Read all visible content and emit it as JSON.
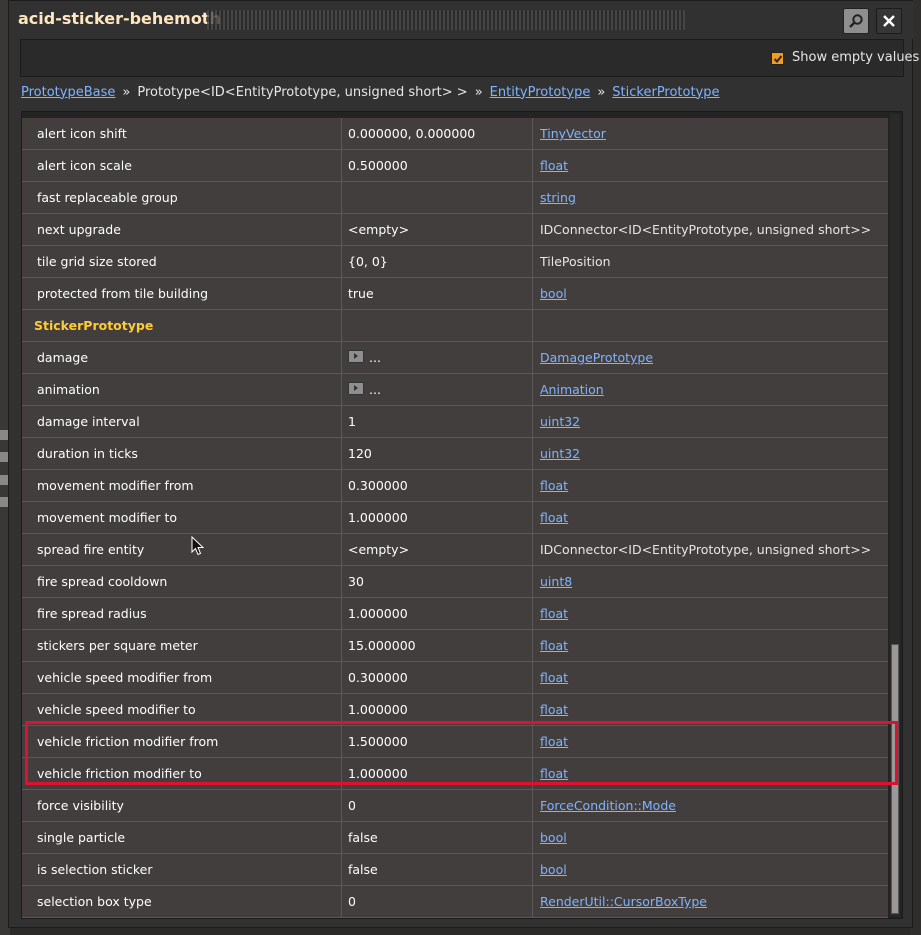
{
  "window": {
    "title": "acid-sticker-behemoth",
    "icons": {
      "search": "magnifier-icon",
      "close": "close-icon"
    }
  },
  "header": {
    "show_empty_values": {
      "label": "Show empty values",
      "checked": true
    }
  },
  "breadcrumb": {
    "items": [
      {
        "label": "PrototypeBase",
        "link": true
      },
      {
        "label": "Prototype<ID<EntityPrototype, unsigned short> >",
        "link": false
      },
      {
        "label": "EntityPrototype",
        "link": true
      },
      {
        "label": "StickerPrototype",
        "link": true
      }
    ],
    "separator": "»"
  },
  "rows": [
    {
      "name": "alert icon shift",
      "value": "0.000000, 0.000000",
      "type": "TinyVector",
      "type_link": true
    },
    {
      "name": "alert icon scale",
      "value": "0.500000",
      "type": "float",
      "type_link": true
    },
    {
      "name": "fast replaceable group",
      "value": "",
      "type": "string",
      "type_link": true
    },
    {
      "name": "next upgrade",
      "value": "<empty>",
      "type": "IDConnector<ID<EntityPrototype, unsigned short>>",
      "type_link": false
    },
    {
      "name": "tile grid size stored",
      "value": "{0, 0}",
      "type": "TilePosition",
      "type_link": false
    },
    {
      "name": "protected from tile building",
      "value": "true",
      "type": "bool",
      "type_link": true
    },
    {
      "name": "StickerPrototype",
      "value": "",
      "type": "",
      "section": true
    },
    {
      "name": "damage",
      "value": "...",
      "type": "DamagePrototype",
      "type_link": true,
      "expandable": true
    },
    {
      "name": "animation",
      "value": "...",
      "type": "Animation",
      "type_link": true,
      "expandable": true
    },
    {
      "name": "damage interval",
      "value": "1",
      "type": "uint32",
      "type_link": true
    },
    {
      "name": "duration in ticks",
      "value": "120",
      "type": "uint32",
      "type_link": true
    },
    {
      "name": "movement modifier from",
      "value": "0.300000",
      "type": "float",
      "type_link": true
    },
    {
      "name": "movement modifier to",
      "value": "1.000000",
      "type": "float",
      "type_link": true
    },
    {
      "name": "spread fire entity",
      "value": "<empty>",
      "type": "IDConnector<ID<EntityPrototype, unsigned short>>",
      "type_link": false
    },
    {
      "name": "fire spread cooldown",
      "value": "30",
      "type": "uint8",
      "type_link": true
    },
    {
      "name": "fire spread radius",
      "value": "1.000000",
      "type": "float",
      "type_link": true
    },
    {
      "name": "stickers per square meter",
      "value": "15.000000",
      "type": "float",
      "type_link": true
    },
    {
      "name": "vehicle speed modifier from",
      "value": "0.300000",
      "type": "float",
      "type_link": true
    },
    {
      "name": "vehicle speed modifier to",
      "value": "1.000000",
      "type": "float",
      "type_link": true
    },
    {
      "name": "vehicle friction modifier from",
      "value": "1.500000",
      "type": "float",
      "type_link": true
    },
    {
      "name": "vehicle friction modifier to",
      "value": "1.000000",
      "type": "float",
      "type_link": true
    },
    {
      "name": "force visibility",
      "value": "0",
      "type": "ForceCondition::Mode",
      "type_link": true
    },
    {
      "name": "single particle",
      "value": "false",
      "type": "bool",
      "type_link": true
    },
    {
      "name": "is selection sticker",
      "value": "false",
      "type": "bool",
      "type_link": true
    },
    {
      "name": "selection box type",
      "value": "0",
      "type": "RenderUtil::CursorBoxType",
      "type_link": true
    }
  ],
  "colors": {
    "title": "#ffe6c0",
    "link": "#7fb4ff",
    "section": "#ffcc33",
    "highlight": "#e01030",
    "checkbox": "#f39c1c",
    "row_bg": "#423e3e"
  },
  "scroll": {
    "position_fraction": 0.66
  }
}
